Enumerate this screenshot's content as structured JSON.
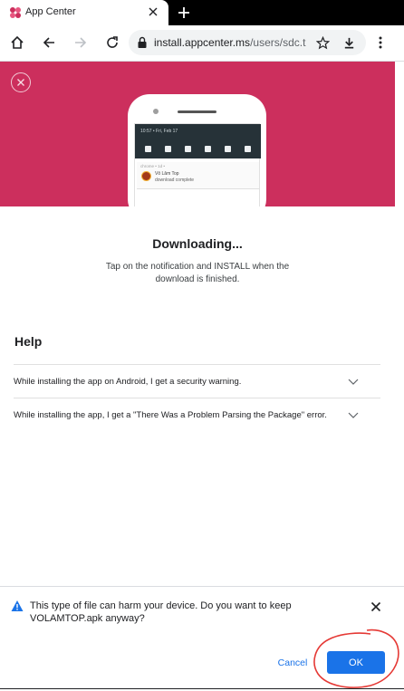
{
  "tab": {
    "title": "App Center"
  },
  "toolbar": {
    "url_host": "install.appcenter.ms",
    "url_path": "/users/sdc.t"
  },
  "hero": {
    "notification_shade_time": "10:57 • Fri, Feb 17",
    "notification_app": "chrome • 1d •",
    "notification_title": "Vô Lâm Top",
    "notification_subtitle": "download complete"
  },
  "content": {
    "title": "Downloading...",
    "description": "Tap on the notification and INSTALL when the download is finished."
  },
  "help": {
    "title": "Help",
    "items": [
      {
        "label": "While installing the app on Android, I get a security warning."
      },
      {
        "label": "While installing the app, I get a \"There Was a Problem Parsing the Package\" error."
      }
    ]
  },
  "download_bar": {
    "message": "This type of file can harm your device. Do you want to keep VOLAMTOP.apk anyway?",
    "cancel_label": "Cancel",
    "ok_label": "OK"
  },
  "colors": {
    "hero_bg": "#cc2f5d",
    "primary_blue": "#1a73e8",
    "annotation_red": "#e53935"
  }
}
